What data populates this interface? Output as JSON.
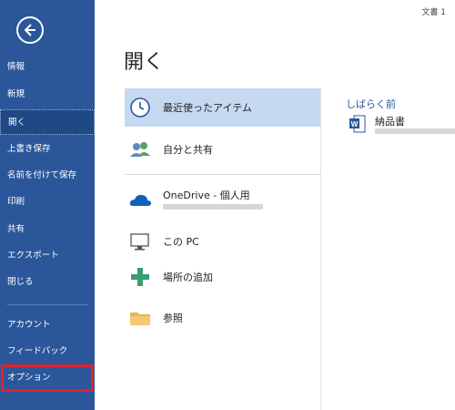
{
  "sidebar": {
    "items": [
      {
        "label": "情報"
      },
      {
        "label": "新規"
      },
      {
        "label": "開く"
      },
      {
        "label": "上書き保存"
      },
      {
        "label": "名前を付けて保存"
      },
      {
        "label": "印刷"
      },
      {
        "label": "共有"
      },
      {
        "label": "エクスポート"
      },
      {
        "label": "閉じる"
      },
      {
        "label": "アカウント"
      },
      {
        "label": "フィードバック"
      },
      {
        "label": "オプション"
      }
    ],
    "active": "開く",
    "highlighted": "オプション",
    "highlight_color": "#e0212e"
  },
  "header": {
    "document_title": "文書 1"
  },
  "page": {
    "title": "開く"
  },
  "locations": [
    {
      "label": "最近使ったアイテム",
      "icon": "clock-icon"
    },
    {
      "label": "自分と共有",
      "icon": "people-icon"
    },
    {
      "label": "OneDrive - 個人用",
      "icon": "cloud-icon"
    },
    {
      "label": "この PC",
      "icon": "pc-icon"
    },
    {
      "label": "場所の追加",
      "icon": "plus-icon"
    },
    {
      "label": "参照",
      "icon": "folder-icon"
    }
  ],
  "recent": {
    "heading": "しばらく前",
    "items": [
      {
        "name": "納品書",
        "icon": "word-doc-icon"
      }
    ]
  },
  "colors": {
    "sidebar": "#2b579a",
    "selection": "#c5d9f1",
    "accent": "#2b579a"
  }
}
